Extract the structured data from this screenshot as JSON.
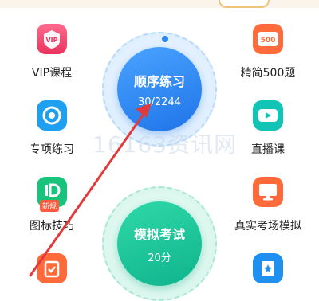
{
  "left_items": [
    {
      "label": "VIP课程",
      "icon": "vip-badge-icon",
      "badge_text": "VIP"
    },
    {
      "label": "专项练习",
      "icon": "target-icon"
    },
    {
      "label": "图标技巧",
      "icon": "sign-tips-icon",
      "badge_text": "新规"
    }
  ],
  "right_items": [
    {
      "label": "精简500题",
      "icon": "question-bank-500-icon",
      "badge_text": "500"
    },
    {
      "label": "直播课",
      "icon": "video-camera-icon"
    },
    {
      "label": "真实考场模拟",
      "icon": "monitor-icon"
    }
  ],
  "sequential": {
    "title": "顺序练习",
    "count": "30/2244"
  },
  "mock_exam": {
    "title": "模拟考试",
    "score": "20分"
  },
  "watermark": "16163资讯网",
  "colors": {
    "blue": "#2f86f0",
    "green": "#16c49a",
    "red": "#e23a3a",
    "orange": "#ff6b3b",
    "cyan": "#12b6c9"
  }
}
